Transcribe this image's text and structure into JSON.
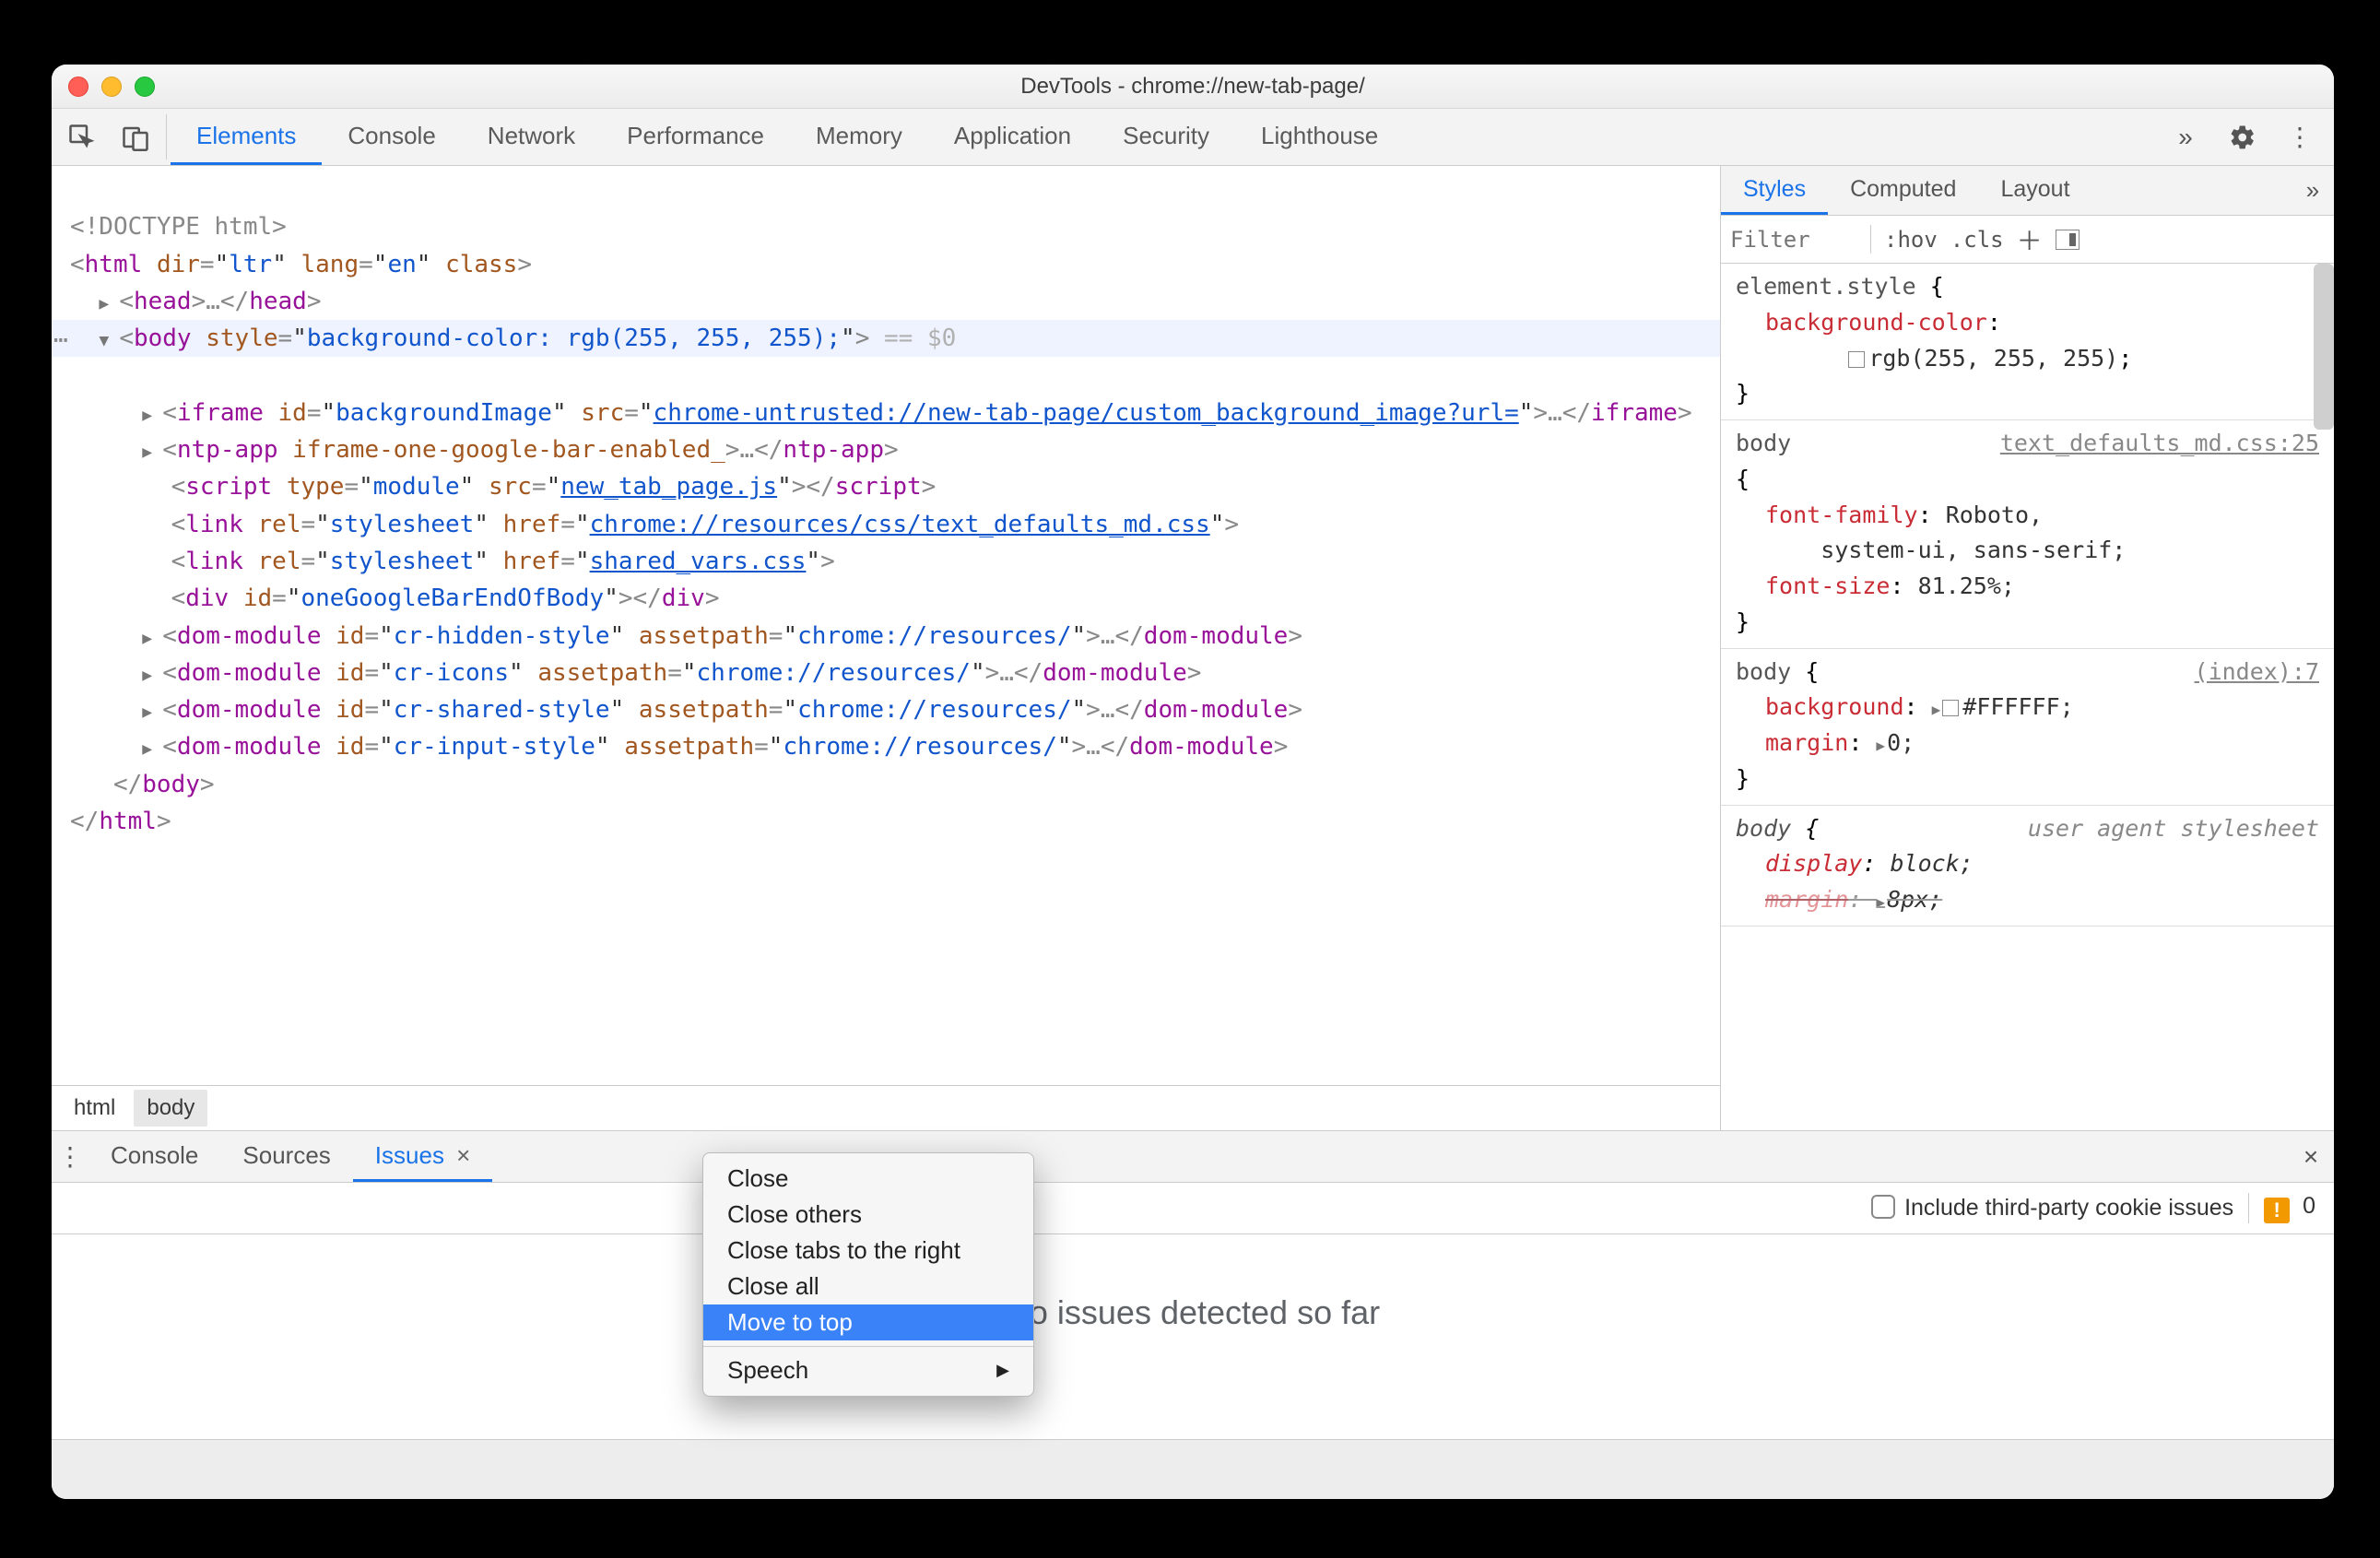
{
  "window": {
    "title": "DevTools - chrome://new-tab-page/"
  },
  "main_tabs": [
    "Elements",
    "Console",
    "Network",
    "Performance",
    "Memory",
    "Application",
    "Security",
    "Lighthouse"
  ],
  "main_tab_active": 0,
  "styles_tabs": [
    "Styles",
    "Computed",
    "Layout"
  ],
  "styles_tab_active": 0,
  "styles_toolbar": {
    "filter_placeholder": "Filter",
    "hov": ":hov",
    "cls": ".cls"
  },
  "style_rules": [
    {
      "selector": "element.style",
      "brace_open": "{",
      "origin": "",
      "props": [
        {
          "name": "background-color",
          "value": "rgb(255, 255, 255)",
          "swatch": true
        }
      ],
      "brace_close": "}"
    },
    {
      "selector": "body",
      "brace_open": "{",
      "origin": "text_defaults_md.css:25",
      "origin_link": true,
      "props": [
        {
          "name": "font-family",
          "value": "Roboto,"
        },
        {
          "indent_value": "system-ui, sans-serif;"
        },
        {
          "name": "font-size",
          "value": "81.25%;"
        }
      ],
      "brace_close": "}"
    },
    {
      "selector": "body",
      "brace_open": "{",
      "origin": "(index):7",
      "origin_link": true,
      "props": [
        {
          "name": "background",
          "value": "#FFFFFF;",
          "tri": true,
          "swatch": true
        },
        {
          "name": "margin",
          "value": "0;",
          "tri": true
        }
      ],
      "brace_close": "}"
    },
    {
      "selector": "body",
      "brace_open": "{",
      "origin": "user agent stylesheet",
      "italic": true,
      "props": [
        {
          "name": "display",
          "value": "block;"
        },
        {
          "name": "margin",
          "value": "8px;",
          "tri": true,
          "struck": true
        }
      ],
      "brace_close": ""
    }
  ],
  "breadcrumbs": [
    "html",
    "body"
  ],
  "dom": {
    "doctype": "<!DOCTYPE html>",
    "html_open": "<html dir=\"ltr\" lang=\"en\" class>",
    "head": "<head>…</head>",
    "body_open": "<body style=\"background-color: rgb(255, 255, 255);\">",
    "body_tail": " == $0",
    "iframe_a": "<iframe id=\"backgroundImage\" src=\"",
    "iframe_link": "chrome-untrusted://new-tab-page/custom_background_image?url=",
    "iframe_b": "\">…</iframe>",
    "ntp": "<ntp-app iframe-one-google-bar-enabled_>…</ntp-app>",
    "script_a": "<script type=\"module\" src=\"",
    "script_link": "new_tab_page.js",
    "script_b": "\"></script>",
    "link1_a": "<link rel=\"stylesheet\" href=\"",
    "link1_link": "chrome://resources/css/text_defaults_md.css",
    "link1_b": "\">",
    "link2_a": "<link rel=\"stylesheet\" href=\"",
    "link2_link": "shared_vars.css",
    "link2_b": "\">",
    "divone": "<div id=\"oneGoogleBarEndOfBody\"></div>",
    "dm1": "<dom-module id=\"cr-hidden-style\" assetpath=\"chrome://resources/\">…</dom-module>",
    "dm2": "<dom-module id=\"cr-icons\" assetpath=\"chrome://resources/\">…</dom-module>",
    "dm3": "<dom-module id=\"cr-shared-style\" assetpath=\"chrome://resources/\">…</dom-module>",
    "dm4": "<dom-module id=\"cr-input-style\" assetpath=\"chrome://resources/\">…</dom-module>",
    "body_close": "</body>",
    "html_close": "</html>"
  },
  "drawer_tabs": [
    "Console",
    "Sources",
    "Issues"
  ],
  "drawer_tab_active": 2,
  "issues": {
    "checkbox_label": "Include third-party cookie issues",
    "count": "0",
    "empty": "No issues detected so far"
  },
  "context_menu": {
    "items": [
      "Close",
      "Close others",
      "Close tabs to the right",
      "Close all",
      "Move to top"
    ],
    "highlight": 4,
    "submenu": "Speech"
  }
}
